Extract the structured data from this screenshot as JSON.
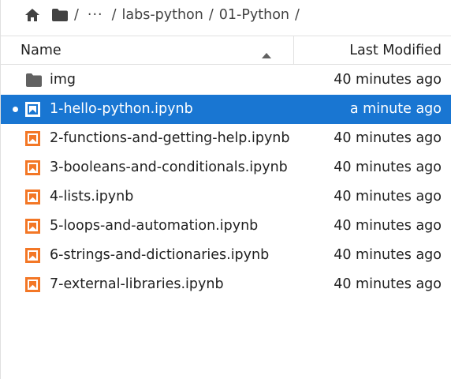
{
  "breadcrumbs": {
    "separator": "/",
    "ellipsis": "···",
    "items": [
      "labs-python",
      "01-Python"
    ]
  },
  "header": {
    "name_label": "Name",
    "modified_label": "Last Modified",
    "sort": "ascending"
  },
  "files": [
    {
      "name": "img",
      "type": "folder",
      "modified": "40 minutes ago",
      "selected": false,
      "running": false
    },
    {
      "name": "1-hello-python.ipynb",
      "type": "notebook",
      "modified": "a minute ago",
      "selected": true,
      "running": true
    },
    {
      "name": "2-functions-and-getting-help.ipynb",
      "type": "notebook",
      "modified": "40 minutes ago",
      "selected": false,
      "running": false
    },
    {
      "name": "3-booleans-and-conditionals.ipynb",
      "type": "notebook",
      "modified": "40 minutes ago",
      "selected": false,
      "running": false
    },
    {
      "name": "4-lists.ipynb",
      "type": "notebook",
      "modified": "40 minutes ago",
      "selected": false,
      "running": false
    },
    {
      "name": "5-loops-and-automation.ipynb",
      "type": "notebook",
      "modified": "40 minutes ago",
      "selected": false,
      "running": false
    },
    {
      "name": "6-strings-and-dictionaries.ipynb",
      "type": "notebook",
      "modified": "40 minutes ago",
      "selected": false,
      "running": false
    },
    {
      "name": "7-external-libraries.ipynb",
      "type": "notebook",
      "modified": "40 minutes ago",
      "selected": false,
      "running": false
    }
  ],
  "colors": {
    "selection": "#1976d2",
    "notebook_icon": "#f37726",
    "folder_icon": "#616161"
  }
}
